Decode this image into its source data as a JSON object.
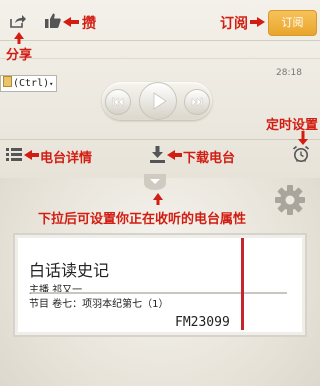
{
  "header": {
    "share_label": "分享",
    "like_label": "攒",
    "subscribe_annotation": "订阅",
    "subscribe_button": "订阅"
  },
  "player": {
    "ctrl_badge": "(Ctrl)",
    "time": "28:18"
  },
  "bottom_bar": {
    "details_label": "电台详情",
    "download_label": "下载电台",
    "timer_label": "定时设置"
  },
  "hint": "下拉后可设置你正在收听的电台属性",
  "station": {
    "title": "白话读史记",
    "host": "主播 祁又一",
    "program": "节目 卷七：项羽本纪第七（1）",
    "frequency": "FM23099"
  },
  "colors": {
    "annotation": "#d21d12",
    "subscribe": "#efb444",
    "needle": "#c4262b"
  }
}
